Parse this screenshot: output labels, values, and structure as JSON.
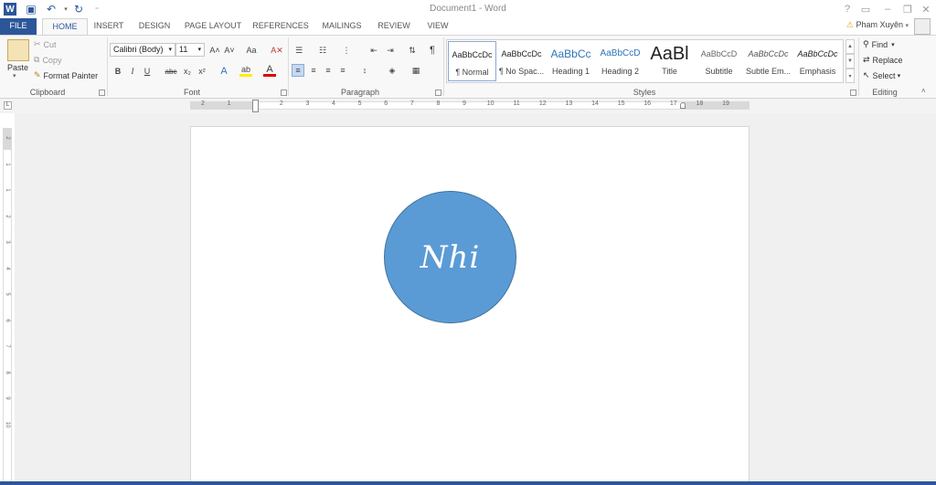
{
  "window": {
    "title": "Document1 - Word",
    "help": "?",
    "restore_ribbon": "▭",
    "minimize": "–",
    "maximize": "❐",
    "close": "✕"
  },
  "quick_access": {
    "word_icon": "W",
    "save": "💾",
    "undo": "↶",
    "redo": "↻",
    "customize": "⁼"
  },
  "tabs": [
    "FILE",
    "HOME",
    "INSERT",
    "DESIGN",
    "PAGE LAYOUT",
    "REFERENCES",
    "MAILINGS",
    "REVIEW",
    "VIEW"
  ],
  "user": {
    "name": "Pham Xuyên",
    "warning": "⚠"
  },
  "clipboard": {
    "paste": "Paste",
    "cut": "Cut",
    "copy": "Copy",
    "format_painter": "Format Painter",
    "label": "Clipboard"
  },
  "font": {
    "name": "Calibri (Body)",
    "size": "11",
    "label": "Font",
    "grow": "A˄",
    "shrink": "A˅",
    "case": "Aa",
    "clear": "A✕",
    "bold": "B",
    "italic": "I",
    "underline": "U",
    "strike": "abc",
    "sub": "x₂",
    "sup": "x²",
    "effects": "A",
    "highlight": "ab",
    "color": "A"
  },
  "paragraph": {
    "label": "Paragraph",
    "pilcrow": "¶"
  },
  "styles": {
    "label": "Styles",
    "items": [
      {
        "preview": "AaBbCcDc",
        "name": "¶ Normal"
      },
      {
        "preview": "AaBbCcDc",
        "name": "¶ No Spac..."
      },
      {
        "preview": "AaBbCc",
        "name": "Heading 1"
      },
      {
        "preview": "AaBbCcD",
        "name": "Heading 2"
      },
      {
        "preview": "AaBl",
        "name": "Title"
      },
      {
        "preview": "AaBbCcD",
        "name": "Subtitle"
      },
      {
        "preview": "AaBbCcDc",
        "name": "Subtle Em..."
      },
      {
        "preview": "AaBbCcDc",
        "name": "Emphasis"
      }
    ]
  },
  "editing": {
    "find": "Find",
    "replace": "Replace",
    "select": "Select",
    "label": "Editing"
  },
  "ruler": {
    "h_ticks": [
      "2",
      "1",
      "1",
      "2",
      "3",
      "4",
      "5",
      "6",
      "7",
      "8",
      "9",
      "10",
      "11",
      "12",
      "13",
      "14",
      "15",
      "16",
      "17",
      "18",
      "19"
    ],
    "v_ticks": [
      "2",
      "1",
      "1",
      "2",
      "3",
      "4",
      "5",
      "6",
      "7",
      "8",
      "9",
      "10"
    ]
  },
  "document": {
    "circle_text": "Nhi"
  },
  "colors": {
    "accent": "#2b579a",
    "shape_fill": "#5b9bd5",
    "shape_outline": "#41719c"
  }
}
